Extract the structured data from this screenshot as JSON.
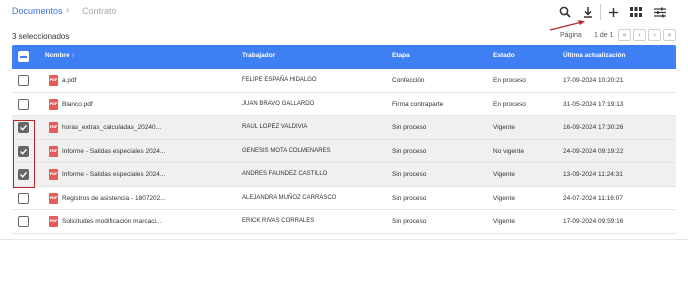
{
  "breadcrumb": {
    "parent": "Documentos",
    "separator": "›",
    "current": "Contrato"
  },
  "toolbar": {
    "icons": [
      "search-icon",
      "download-icon",
      "plus-icon",
      "grid-view-icon",
      "filter-settings-icon"
    ],
    "annotation_color": "#b22a2a"
  },
  "selection": {
    "count_label": "3 seleccionados"
  },
  "pagination": {
    "label": "Página",
    "value": "1 de 1",
    "first": "«",
    "prev": "‹",
    "next": "›",
    "last": "»"
  },
  "table": {
    "header_color": "#3f7ff4",
    "columns": {
      "name": "Nombre ↑",
      "worker": "Trabajador",
      "stage": "Etapa",
      "state": "Estado",
      "updated": "Última actualización"
    },
    "rows": [
      {
        "checked": false,
        "name": "a.pdf",
        "worker": "FELIPE ESPAÑA HIDALGO",
        "stage": "Confección",
        "state": "En proceso",
        "updated": "17-09-2024 10:20:21"
      },
      {
        "checked": false,
        "name": "Blanco.pdf",
        "worker": "JUAN BRAVO GALLARDO",
        "stage": "Firma contraparte",
        "state": "En proceso",
        "updated": "31-05-2024 17:19:13"
      },
      {
        "checked": true,
        "name": "horas_extras_calculadas_20240...",
        "worker": "RAUL LOPEZ VALDIVIA",
        "stage": "Sin proceso",
        "state": "Vigente",
        "updated": "16-09-2024 17:30:26"
      },
      {
        "checked": true,
        "name": "Informe - Salidas especiales 2024...",
        "worker": "GENESIS MOTA COLMENARES",
        "stage": "Sin proceso",
        "state": "No vigente",
        "updated": "24-09-2024 09:19:22"
      },
      {
        "checked": true,
        "name": "Informe - Salidas especiales 2024...",
        "worker": "ANDRES FAUNDEZ CASTILLO",
        "stage": "Sin proceso",
        "state": "Vigente",
        "updated": "13-09-2024 11:24:31"
      },
      {
        "checked": false,
        "name": "Registros de asistencia - 1807202...",
        "worker": "ALEJANDRA MUÑOZ CARRASCO",
        "stage": "Sin proceso",
        "state": "Vigente",
        "updated": "24-07-2024 11:16:07"
      },
      {
        "checked": false,
        "name": "Solicitudes modificación marcaci...",
        "worker": "ERICK RIVAS CORRALES",
        "stage": "Sin proceso",
        "state": "Vigente",
        "updated": "17-09-2024 09:59:16"
      }
    ]
  }
}
